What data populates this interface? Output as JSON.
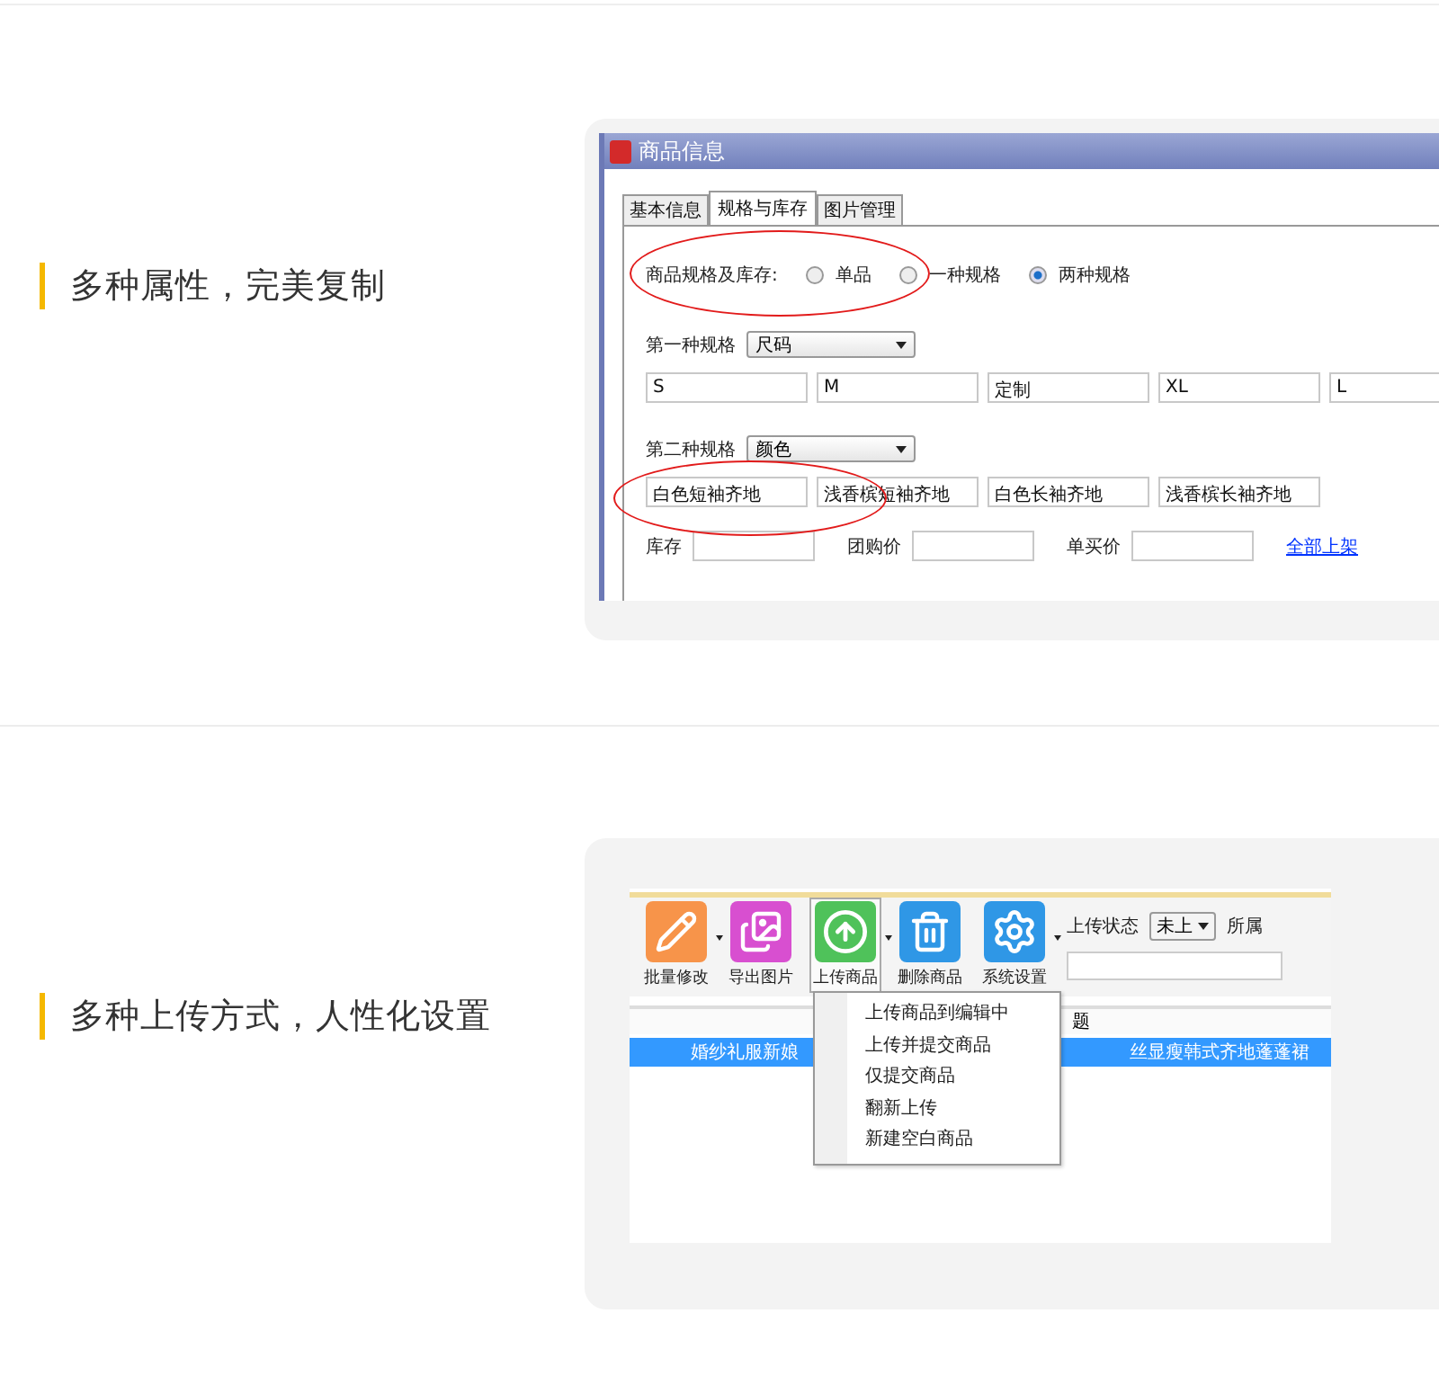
{
  "section_1": {
    "heading": "多种属性，完美复制",
    "window": {
      "title": "商品信息",
      "tabs": [
        {
          "label": "基本信息",
          "selected": false
        },
        {
          "label": "规格与库存",
          "selected": true
        },
        {
          "label": "图片管理",
          "selected": false
        }
      ],
      "spec_mode": {
        "label": "商品规格及库存:",
        "options": [
          {
            "label": "单品",
            "selected": false
          },
          {
            "label": "一种规格",
            "selected": false
          },
          {
            "label": "两种规格",
            "selected": true
          }
        ]
      },
      "specs": [
        {
          "label": "第一种规格",
          "value": "尺码",
          "inputs": [
            "S",
            "M",
            "定制",
            "XL",
            "L"
          ]
        },
        {
          "label": "第二种规格",
          "value": "颜色",
          "inputs": [
            "白色短袖齐地",
            "浅香槟短袖齐地",
            "白色长袖齐地",
            "浅香槟长袖齐地"
          ]
        }
      ],
      "price_fields": [
        {
          "label": "库存"
        },
        {
          "label": "团购价"
        },
        {
          "label": "单买价"
        }
      ],
      "link": "全部上架"
    }
  },
  "section_2": {
    "heading": "多种上传方式，人性化设置",
    "toolbar": [
      {
        "label": "批量修改",
        "kind": "pencil",
        "color": "#f7944a",
        "has_menu": true,
        "pressed": false
      },
      {
        "label": "导出图片",
        "kind": "images",
        "color": "#d84fd0",
        "has_menu": false,
        "pressed": false
      },
      {
        "label": "上传商品",
        "kind": "upload",
        "color": "#4fc25a",
        "has_menu": true,
        "pressed": true
      },
      {
        "label": "删除商品",
        "kind": "trash",
        "color": "#2f97e6",
        "has_menu": false,
        "pressed": false
      },
      {
        "label": "系统设置",
        "kind": "gear",
        "color": "#2f97e6",
        "has_menu": true,
        "pressed": false
      }
    ],
    "status": {
      "label": "上传状态",
      "value": "未上",
      "store_label": "所属"
    },
    "table": {
      "header": "题",
      "row": {
        "selected": true,
        "cells": [
          "婚纱礼服新娘",
          "丝显瘦韩式齐地蓬蓬裙"
        ]
      }
    },
    "menu": [
      "上传商品到编辑中",
      "上传并提交商品",
      "仅提交商品",
      "翻新上传",
      "新建空白商品"
    ]
  }
}
